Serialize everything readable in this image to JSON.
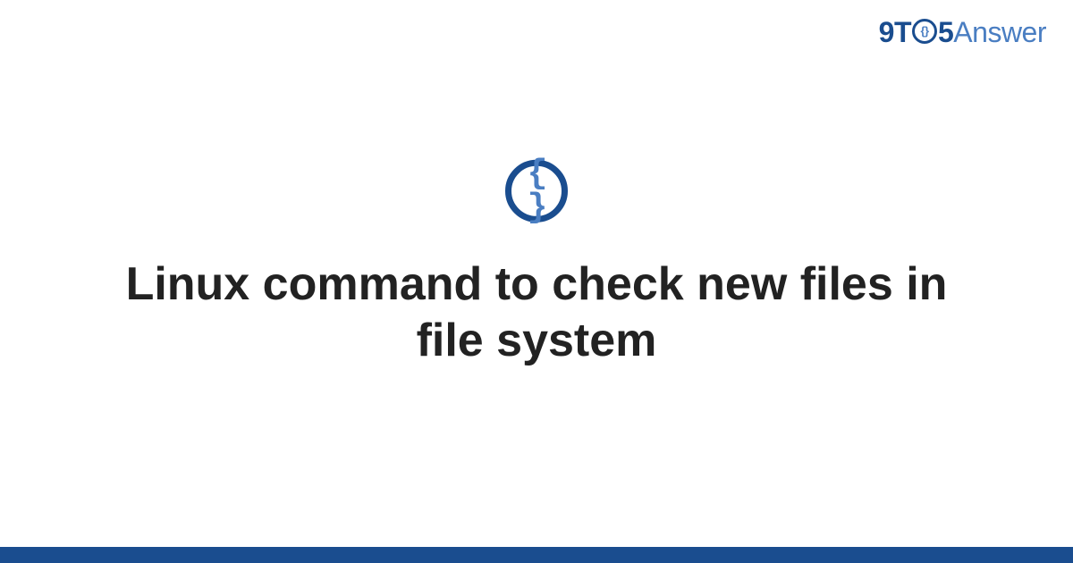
{
  "header": {
    "logo": {
      "part1": "9T",
      "circle_inner": "{}",
      "part2": "5",
      "part3": "Answer"
    }
  },
  "main": {
    "icon_content": "{ }",
    "title": "Linux command to check new files in file system"
  },
  "colors": {
    "primary_dark": "#1a4d8f",
    "primary_light": "#4a7ec2",
    "text": "#222222"
  }
}
